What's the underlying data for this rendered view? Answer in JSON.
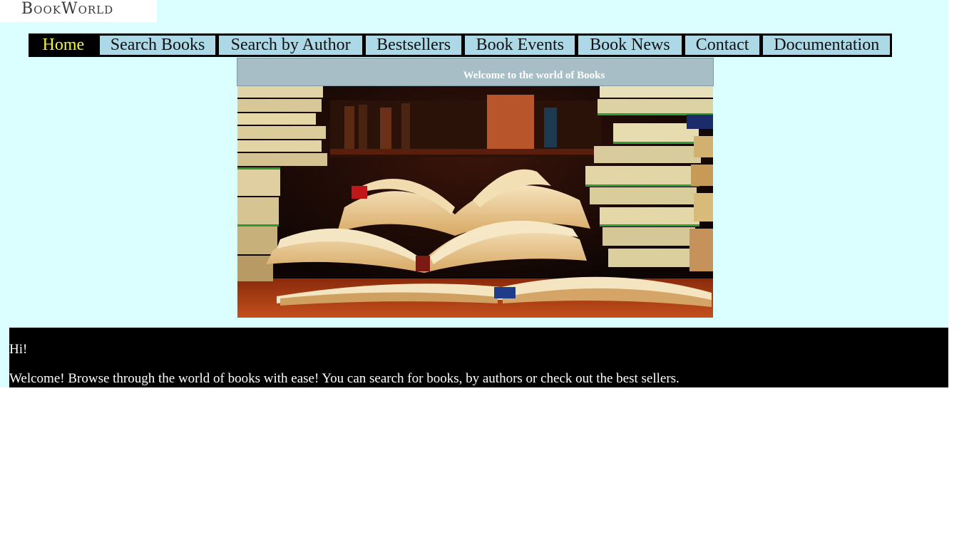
{
  "logo": {
    "text": "BookWorld"
  },
  "nav": {
    "items": [
      {
        "label": "Home"
      },
      {
        "label": "Search Books"
      },
      {
        "label": "Search by Author"
      },
      {
        "label": "Bestsellers"
      },
      {
        "label": "Book Events"
      },
      {
        "label": "Book News"
      },
      {
        "label": "Contact"
      },
      {
        "label": "Documentation"
      }
    ]
  },
  "banner": {
    "title": "Welcome to the world of Books"
  },
  "hero": {
    "image": "books-photo"
  },
  "welcome": {
    "greeting": "Hi!",
    "message": "Welcome! Browse through the world of books with ease! You can search for books, by authors or check out the best sellers."
  },
  "colors": {
    "page_bg": "#dbffff",
    "nav_bg": "#000000",
    "nav_item_bg": "#add8e6",
    "nav_active_text": "#f2f23a",
    "banner_bg": "#a8bec6"
  }
}
